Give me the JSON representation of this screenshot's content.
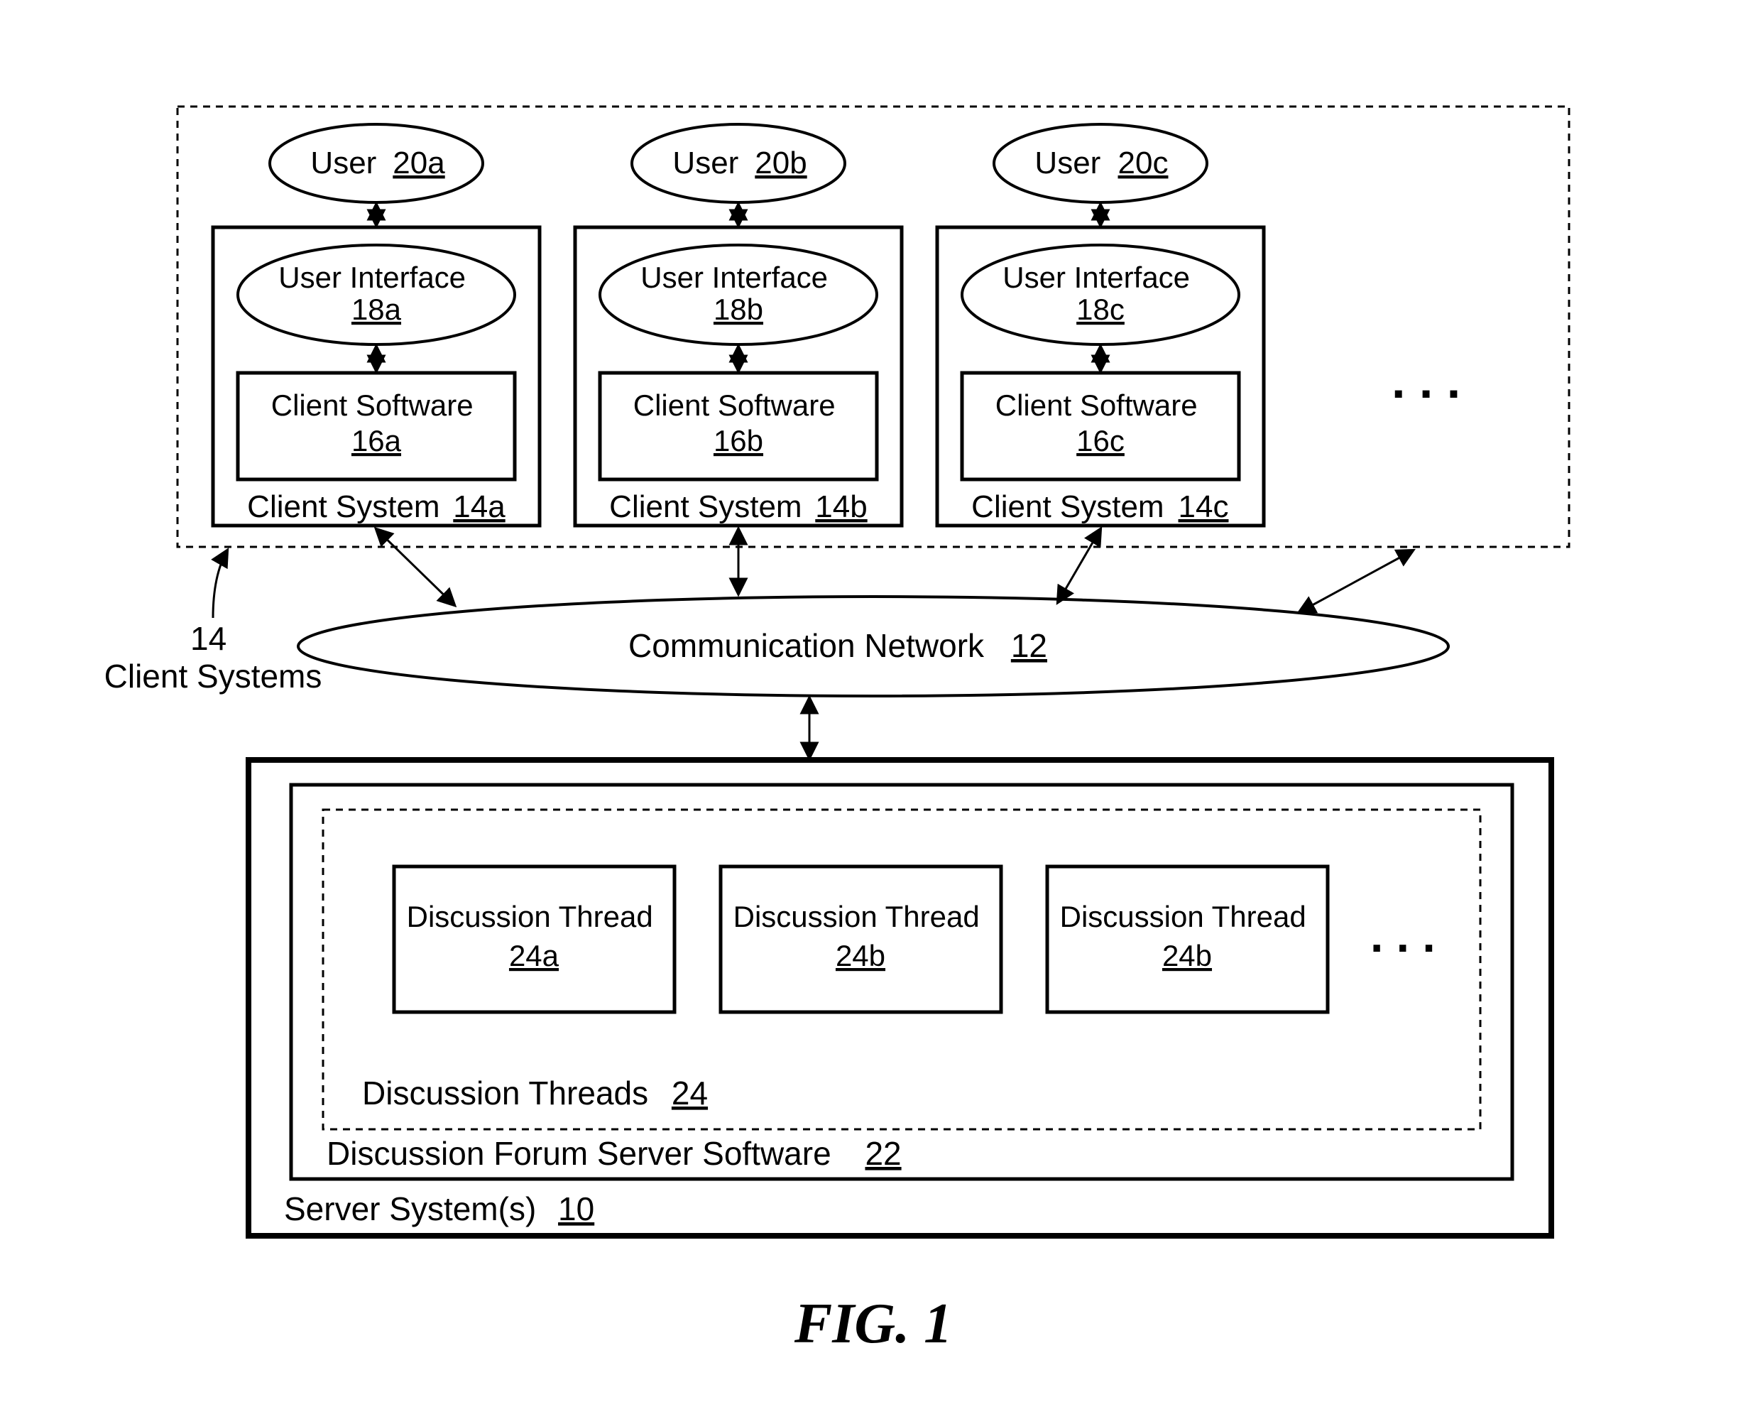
{
  "figure_label": "FIG. 1",
  "client_systems_group": {
    "ref_num": "14",
    "ref_label": "Client Systems"
  },
  "clients": [
    {
      "system_label": "Client System",
      "system_ref": "14a",
      "user_label": "User",
      "user_ref": "20a",
      "ui_label": "User Interface",
      "ui_ref": "18a",
      "sw_label": "Client Software",
      "sw_ref": "16a"
    },
    {
      "system_label": "Client System",
      "system_ref": "14b",
      "user_label": "User",
      "user_ref": "20b",
      "ui_label": "User Interface",
      "ui_ref": "18b",
      "sw_label": "Client Software",
      "sw_ref": "16b"
    },
    {
      "system_label": "Client System",
      "system_ref": "14c",
      "user_label": "User",
      "user_ref": "20c",
      "ui_label": "User Interface",
      "ui_ref": "18c",
      "sw_label": "Client Software",
      "sw_ref": "16c"
    }
  ],
  "network": {
    "label": "Communication Network",
    "ref": "12"
  },
  "server": {
    "system_label": "Server System(s)",
    "system_ref": "10",
    "software_label": "Discussion Forum Server Software",
    "software_ref": "22",
    "threads_group_label": "Discussion Threads",
    "threads_group_ref": "24",
    "threads": [
      {
        "label": "Discussion Thread",
        "ref": "24a"
      },
      {
        "label": "Discussion Thread",
        "ref": "24b"
      },
      {
        "label": "Discussion Thread",
        "ref": "24b"
      }
    ]
  },
  "ellipsis": ".  .  ."
}
